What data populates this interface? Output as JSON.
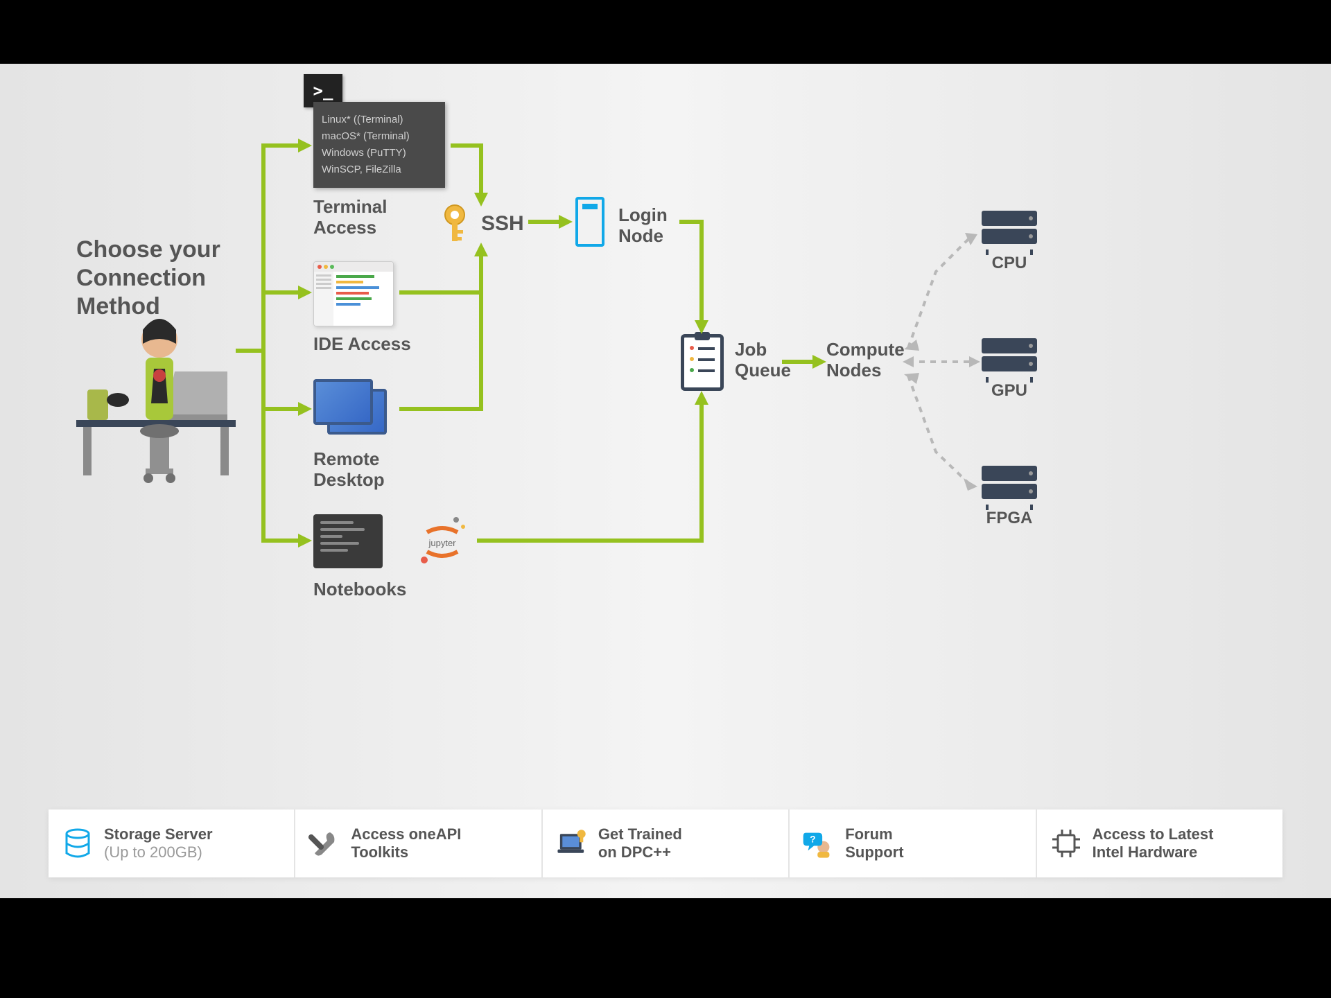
{
  "title": "Choose your\nConnection\nMethod",
  "terminal": {
    "lines": [
      "Linux* ((Terminal)",
      "macOS* (Terminal)",
      "Windows (PuTTY)",
      "WinSCP, FileZilla"
    ],
    "label": "Terminal\nAccess"
  },
  "ide": {
    "label": "IDE Access"
  },
  "remote": {
    "label": "Remote\nDesktop"
  },
  "notebooks": {
    "label": "Notebooks"
  },
  "jupyter": {
    "label": "jupyter"
  },
  "ssh": {
    "label": "SSH"
  },
  "login": {
    "label": "Login\nNode"
  },
  "jobqueue": {
    "label": "Job\nQueue"
  },
  "compute": {
    "label": "Compute\nNodes"
  },
  "targets": {
    "cpu": "CPU",
    "gpu": "GPU",
    "fpga": "FPGA"
  },
  "footer": {
    "storage": {
      "title": "Storage Server",
      "sub": "(Up to 200GB)"
    },
    "oneapi": {
      "title": "Access oneAPI\nToolkits"
    },
    "trained": {
      "title": "Get Trained\non DPC++"
    },
    "forum": {
      "title": "Forum\nSupport"
    },
    "hardware": {
      "title": "Access to Latest\nIntel Hardware"
    }
  }
}
